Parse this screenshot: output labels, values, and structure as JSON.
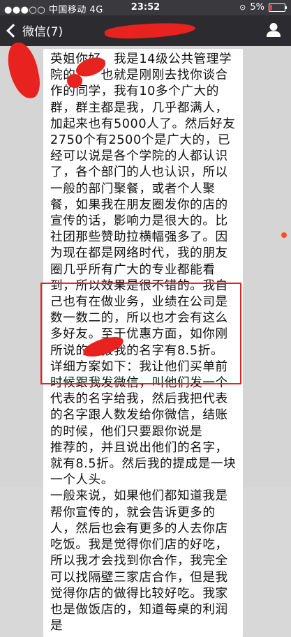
{
  "status_bar": {
    "carrier": "●●●○○ 中国移动 4G",
    "time": "23:52",
    "battery": "5%",
    "battery_level": 0.05
  },
  "nav_bar": {
    "back_label": "微信(7)",
    "profile_icon": "person-icon"
  },
  "message": {
    "paragraphs": [
      "英姐你好，我是14级公共管理学院的　　也就是刚刚去找你谈合作的同学，我有10多个广大的群，群主都是我，几乎都满人，加起来也有5000人了。然后好友2750个有2500个是广大的，已经可以说是各个学院的人都认识了，各个部门的人也认识，所以一般的部门聚餐，或者个人聚餐，如果我在朋友圈发你的店的宣传的话，影响力是很大的。比社团那些赞助拉横幅强多了。因为现在都是网络时代，我的朋友圈几乎所有广大的专业都能看到，所以效果是很不错的。我自己也有在做业务，业绩在公司是数一数二的，所以也才会有这么多好友。至于优惠方面，如你刚所说的，报我的名字有8.5折。",
      "详细方案如下：我让他们买单前时候跟我发微信，叫他们发一个代表的名字给我，然后我把代表的名字跟人数发给你微信，结账的时候，他们只要跟你说是　　推荐的，并且说出他们的名字，就有8.5折。然后我的提成是一块一个人头。",
      "一般来说，如果他们都知道我是帮你宣传的，就会告诉更多的人，然后也会有更多的人去你店吃饭。我是觉得你们店的好吃，所以我才会找到你合作，我完全可以找隔壁三家店合作，但是我觉得你店的做得比较好吃。我家也是做饭店的，知道每桌的利润是"
    ]
  },
  "colors": {
    "status_bar": "#3a3a3e",
    "nav_bar": "#2c2c30",
    "background": "#d5d5d5",
    "bubble": "#ffffff",
    "highlight_border": "#e0241f",
    "redaction": "#e8221f"
  }
}
